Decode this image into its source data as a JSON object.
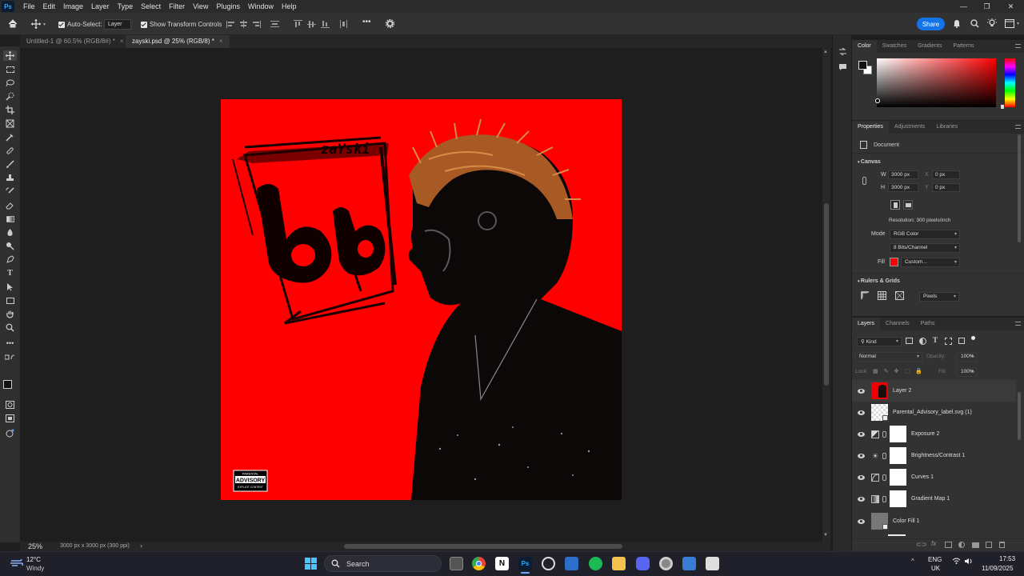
{
  "menubar": {
    "logo": "Ps",
    "items": [
      "File",
      "Edit",
      "Image",
      "Layer",
      "Type",
      "Select",
      "Filter",
      "View",
      "Plugins",
      "Window",
      "Help"
    ]
  },
  "options": {
    "auto_select_label": "Auto-Select:",
    "auto_select_value": "Layer",
    "transform_label": "Show Transform Controls",
    "more": "•••",
    "share_label": "Share"
  },
  "tabs": [
    {
      "label": "Untitled-1 @ 60.5% (RGB/8#) *",
      "close": "×"
    },
    {
      "label": "zayski.psd @ 25% (RGB/8) *",
      "close": "×"
    }
  ],
  "artwork": {
    "brand_text": "zaYski",
    "logo_text": "bb",
    "advisory_top": "PARENTAL",
    "advisory_main": "ADVISORY",
    "advisory_bottom": "EXPLICIT CONTENT",
    "background_color": "#ff0000"
  },
  "status": {
    "zoom": "25%",
    "doc_info": "3000 px x 3000 px (300 ppi)",
    "arrow": "›"
  },
  "color_panel": {
    "tabs": [
      "Color",
      "Swatches",
      "Gradients",
      "Patterns"
    ],
    "active_tab": "Color",
    "hue_color": "#ff0000"
  },
  "properties": {
    "tabs": [
      "Properties",
      "Adjustments",
      "Libraries"
    ],
    "active_tab": "Properties",
    "document_label": "Document",
    "canvas_header": "Canvas",
    "w_label": "W",
    "w_value": "3000 px",
    "h_label": "H",
    "h_value": "3000 px",
    "x_label": "X",
    "x_placeholder": "0 px",
    "y_label": "Y",
    "y_placeholder": "0 px",
    "resolution": "Resolution: 300 pixels/inch",
    "mode_label": "Mode",
    "mode_value": "RGB Color",
    "bits_value": "8 Bits/Channel",
    "fill_label": "Fill",
    "fill_value": "Custom...",
    "fill_color": "#ff0000",
    "rulers_header": "Rulers & Grids",
    "units_value": "Pixels"
  },
  "layers_panel": {
    "tabs": [
      "Layers",
      "Channels",
      "Paths"
    ],
    "active_tab": "Layers",
    "filter_kind": "Kind",
    "blend_mode": "Normal",
    "opacity_label": "Opacity:",
    "opacity_value": "100%",
    "lock_label": "Lock:",
    "fill_label": "Fill:",
    "fill_value": "100%",
    "layers": [
      {
        "name": "Layer 2",
        "kind": "image"
      },
      {
        "name": "Parental_Advisory_label.svg (1)",
        "kind": "smart"
      },
      {
        "name": "Exposure 2",
        "kind": "adjustment"
      },
      {
        "name": "Brightness/Contrast 1",
        "kind": "adjustment"
      },
      {
        "name": "Curves 1",
        "kind": "adjustment"
      },
      {
        "name": "Gradient Map 1",
        "kind": "adjustment"
      },
      {
        "name": "Color Fill 1",
        "kind": "fill"
      }
    ]
  },
  "taskbar": {
    "weather_temp": "12°C",
    "weather_desc": "Windy",
    "search_label": "Search",
    "lang_top": "ENG",
    "lang_bottom": "UK",
    "time": "17:53",
    "date": "11/09/2025"
  }
}
